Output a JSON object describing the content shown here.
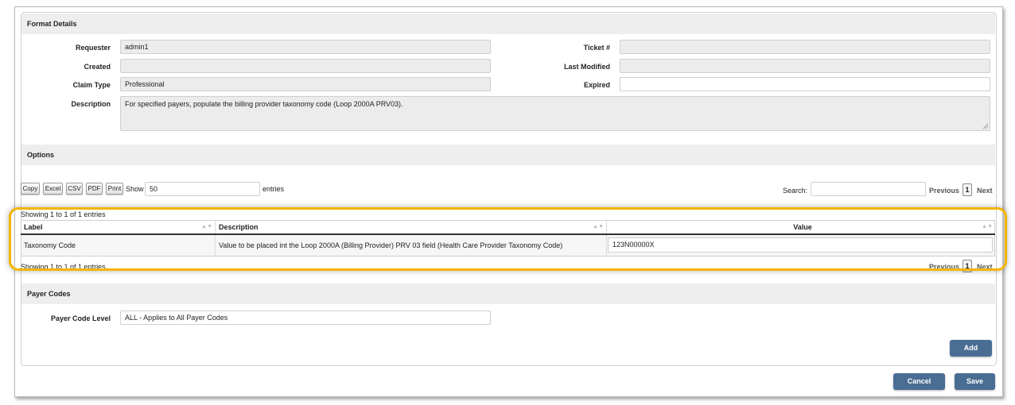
{
  "format_details": {
    "title": "Format Details",
    "requester_label": "Requester",
    "requester_value": "admin1",
    "created_label": "Created",
    "created_value": "",
    "claim_type_label": "Claim Type",
    "claim_type_value": "Professional",
    "description_label": "Description",
    "description_value": "For specified payers, populate the billing provider taxonomy code (Loop 2000A PRV03).",
    "ticket_label": "Ticket #",
    "ticket_value": "",
    "last_modified_label": "Last Modified",
    "last_modified_value": "",
    "expired_label": "Expired",
    "expired_value": ""
  },
  "options": {
    "title": "Options",
    "export_buttons": [
      "Copy",
      "Excel",
      "CSV",
      "PDF",
      "Print"
    ],
    "show_label": "Show",
    "show_value": "50",
    "entries_label": "entries",
    "search_label": "Search:",
    "search_value": "",
    "pagination": {
      "previous": "Previous",
      "page": "1",
      "next": "Next"
    },
    "info_top": "Showing 1 to 1 of 1 entries",
    "info_bottom": "Showing 1 to 1 of 1 entries",
    "table": {
      "headers": [
        "Label",
        "Description",
        "Value"
      ],
      "rows": [
        {
          "label": "Taxonomy Code",
          "description": "Value to be placed int the Loop 2000A (Billing Provider) PRV 03 field (Health Care Provider Taxonomy Code)",
          "value": "123N00000X"
        }
      ]
    }
  },
  "payer_codes": {
    "title": "Payer Codes",
    "level_label": "Payer Code Level",
    "level_value": "ALL - Applies to All Payer Codes",
    "add_label": "Add"
  },
  "footer": {
    "cancel_label": "Cancel",
    "save_label": "Save"
  },
  "colors": {
    "accent_button": "#4a6e93",
    "highlight": "#f4b400",
    "section_bg": "#eeeeee"
  },
  "icons": {
    "sort": "sort-arrows-icon",
    "resize": "resize-grip-icon"
  }
}
